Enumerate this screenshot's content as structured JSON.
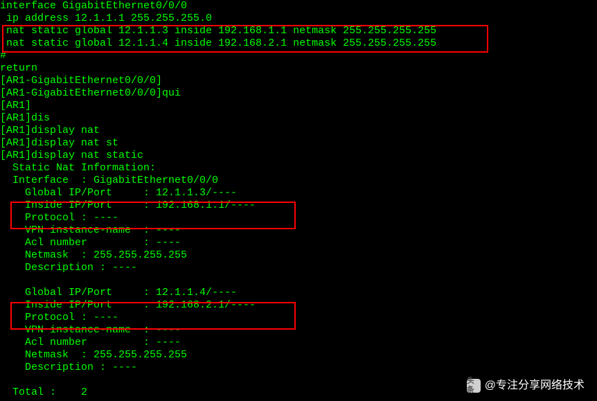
{
  "terminal": {
    "lines": [
      "interface GigabitEthernet0/0/0",
      " ip address 12.1.1.1 255.255.255.0",
      " nat static global 12.1.1.3 inside 192.168.1.1 netmask 255.255.255.255",
      " nat static global 12.1.1.4 inside 192.168.2.1 netmask 255.255.255.255",
      "#",
      "return",
      "[AR1-GigabitEthernet0/0/0]",
      "[AR1-GigabitEthernet0/0/0]qui",
      "[AR1]",
      "[AR1]dis",
      "[AR1]display nat",
      "[AR1]display nat st",
      "[AR1]display nat static",
      "  Static Nat Information:",
      "  Interface  : GigabitEthernet0/0/0",
      "    Global IP/Port     : 12.1.1.3/---- ",
      "    Inside IP/Port     : 192.168.1.1/----",
      "    Protocol : ----     ",
      "    VPN instance-name  : ----                            ",
      "    Acl number         : ----",
      "    Netmask  : 255.255.255.255 ",
      "    Description : ----",
      "",
      "    Global IP/Port     : 12.1.1.4/---- ",
      "    Inside IP/Port     : 192.168.2.1/----",
      "    Protocol : ----     ",
      "    VPN instance-name  : ----                            ",
      "    Acl number         : ----",
      "    Netmask  : 255.255.255.255 ",
      "    Description : ----",
      "",
      "  Total :    2"
    ]
  },
  "watermark": {
    "logo_text": "头条",
    "text": "@专注分享网络技术"
  }
}
